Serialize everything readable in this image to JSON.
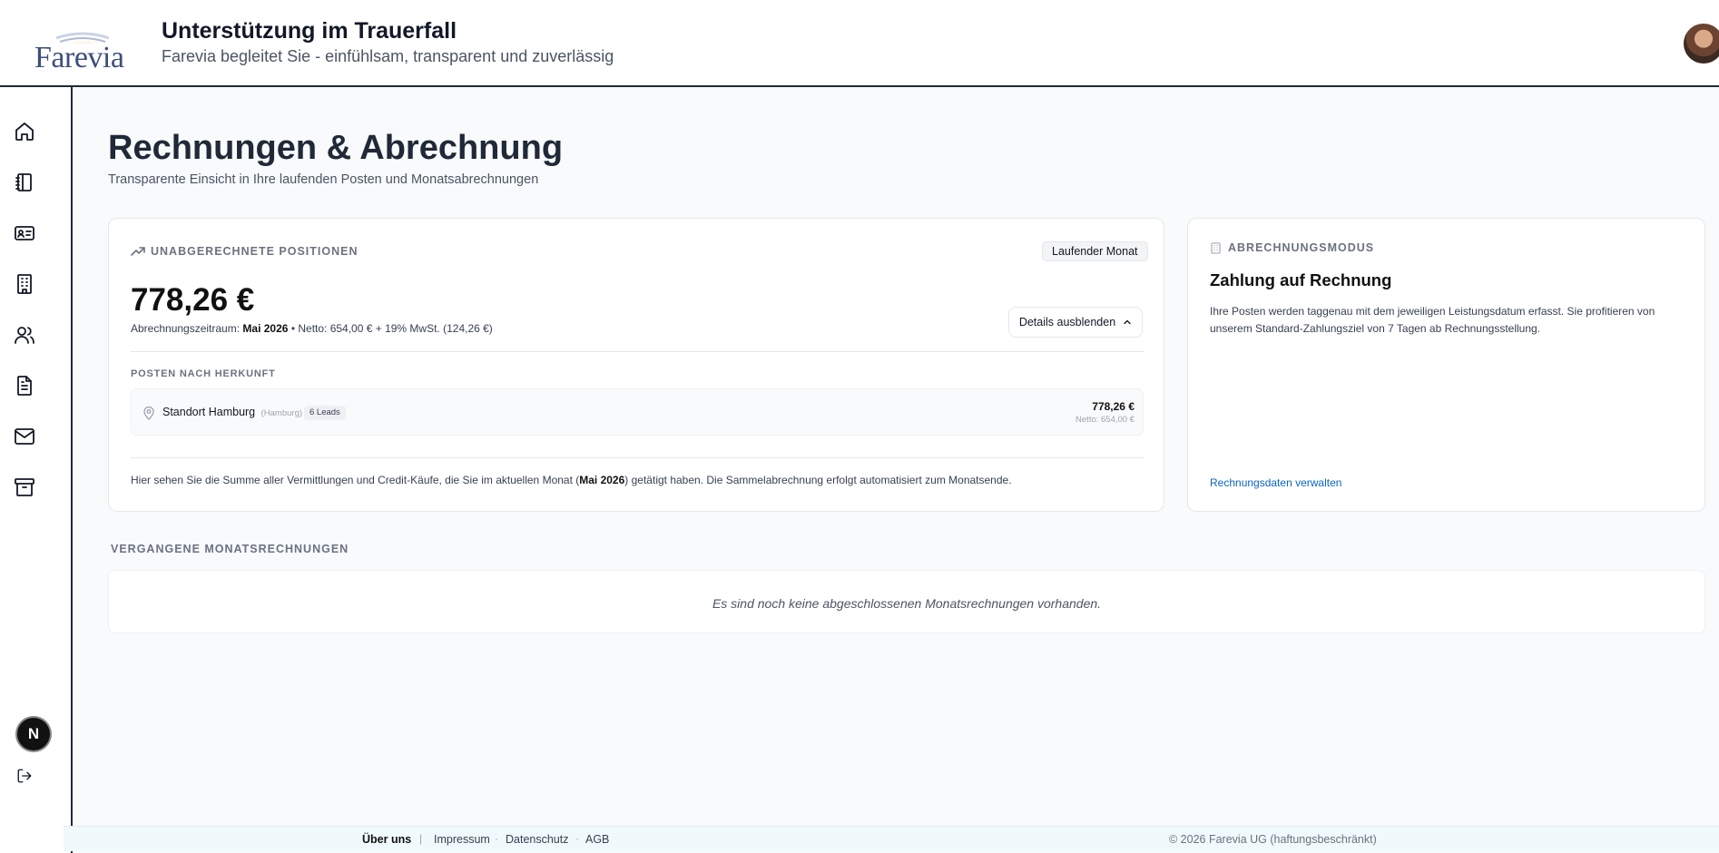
{
  "header": {
    "logo_text": "Farevia",
    "title": "Unterstützung im Trauerfall",
    "subtitle": "Farevia begleitet Sie - einfühlsam, transparent und zuverlässig"
  },
  "sidebar": {
    "items": [
      {
        "icon": "home-icon"
      },
      {
        "icon": "notebook-icon"
      },
      {
        "icon": "id-card-icon"
      },
      {
        "icon": "building-icon"
      },
      {
        "icon": "users-icon"
      },
      {
        "icon": "document-icon"
      },
      {
        "icon": "mail-icon"
      },
      {
        "icon": "archive-icon"
      }
    ],
    "logout_icon": "logout-icon",
    "badge": "N"
  },
  "main": {
    "title": "Rechnungen & Abrechnung",
    "subtitle": "Transparente Einsicht in Ihre laufenden Posten und Monatsabrechnungen",
    "open_items": {
      "label": "UNABGERECHNETE POSITIONEN",
      "badge": "Laufender Monat",
      "amount": "778,26 €",
      "period_prefix": "Abrechnungszeitraum:",
      "period_month": "Mai 2026",
      "period_suffix": "• Netto: 654,00 € + 19% MwSt. (124,26 €)",
      "details_button": "Details ausblenden",
      "posten_label": "POSTEN NACH HERKUNFT",
      "rows": [
        {
          "name": "Standort Hamburg",
          "city": "(Hamburg)",
          "leads": "6 Leads",
          "amount": "778,26 €",
          "netto": "Netto: 654,00 €"
        }
      ],
      "footnote_prefix": "Hier sehen Sie die Summe aller Vermittlungen und Credit-Käufe, die Sie im aktuellen Monat (",
      "footnote_month": "Mai 2026",
      "footnote_suffix": ") getätigt haben. Die Sammelabrechnung erfolgt automatisiert zum Monatsende."
    },
    "billing_mode": {
      "label": "ABRECHNUNGSMODUS",
      "title": "Zahlung auf Rechnung",
      "text": "Ihre Posten werden taggenau mit dem jeweiligen Leistungsdatum erfasst. Sie profitieren von unserem Standard-Zahlungsziel von 7 Tagen ab Rechnungsstellung.",
      "link": "Rechnungsdaten verwalten"
    },
    "past_invoices": {
      "label": "VERGANGENE MONATSRECHNUNGEN",
      "empty_text": "Es sind noch keine abgeschlossenen Monatsrechnungen vorhanden."
    }
  },
  "footer": {
    "about": "Über uns",
    "impressum": "Impressum",
    "datenschutz": "Datenschutz",
    "agb": "AGB",
    "copyright": "© 2026 Farevia UG (haftungsbeschränkt)"
  },
  "colors": {
    "link": "#0b65c2",
    "brand": "#3d4f7c",
    "text_dark": "#111827"
  }
}
